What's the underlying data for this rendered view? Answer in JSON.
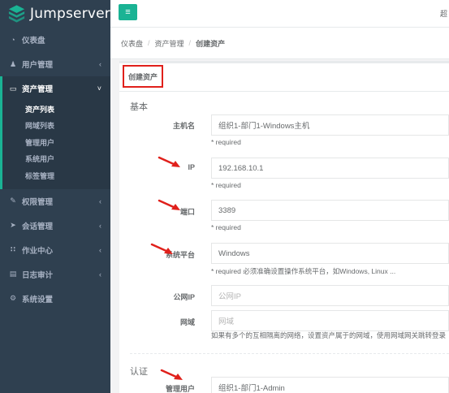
{
  "app": {
    "logo_text": "Jumpserver",
    "user_glyph": "超"
  },
  "sidebar": {
    "items": [
      {
        "label": "仪表盘",
        "icon": "dashboard-icon",
        "glyph": "◔"
      },
      {
        "label": "用户管理",
        "icon": "users-icon",
        "glyph": "♟",
        "arrow": "‹"
      },
      {
        "label": "资产管理",
        "icon": "asset-icon",
        "glyph": "▭",
        "arrow": "˅"
      },
      {
        "label": "权限管理",
        "icon": "edit-icon",
        "glyph": "✎",
        "arrow": "‹"
      },
      {
        "label": "会话管理",
        "icon": "rocket-icon",
        "glyph": "➤",
        "arrow": "‹"
      },
      {
        "label": "作业中心",
        "icon": "sitemap-icon",
        "glyph": "∷",
        "arrow": "‹"
      },
      {
        "label": "日志审计",
        "icon": "log-icon",
        "glyph": "▤",
        "arrow": "‹"
      },
      {
        "label": "系统设置",
        "icon": "settings-icon",
        "glyph": "⚙"
      }
    ],
    "asset_subitems": [
      "资产列表",
      "网域列表",
      "管理用户",
      "系统用户",
      "标签管理"
    ]
  },
  "topbar": {
    "menu_glyph": "≡"
  },
  "breadcrumb": {
    "items": [
      "仪表盘",
      "资产管理",
      "创建资产"
    ],
    "separator": "/"
  },
  "panel": {
    "title": "创建资产"
  },
  "form": {
    "basic_section": "基本",
    "auth_section": "认证",
    "hostname": {
      "label": "主机名",
      "value": "组织1-部门1-Windows主机",
      "help": "* required"
    },
    "ip": {
      "label": "IP",
      "value": "192.168.10.1",
      "help": "* required"
    },
    "port": {
      "label": "端口",
      "value": "3389",
      "help": "* required"
    },
    "platform": {
      "label": "系统平台",
      "value": "Windows",
      "help": "* required 必须准确设置操作系统平台，如Windows, Linux ..."
    },
    "public_ip": {
      "label": "公网IP",
      "placeholder": "公网IP"
    },
    "domain": {
      "label": "网域",
      "placeholder": "网域",
      "help": "如果有多个的互相隔离的网络，设置资产属于的网域，使用网域网关跳转登录"
    },
    "admin_user": {
      "label": "管理用户",
      "value": "组织1-部门1-Admin"
    }
  },
  "colors": {
    "sidebar_bg": "#2f4050",
    "accent": "#1ab394",
    "highlight_box": "#e0201b",
    "arrow_red": "#e0201b"
  }
}
